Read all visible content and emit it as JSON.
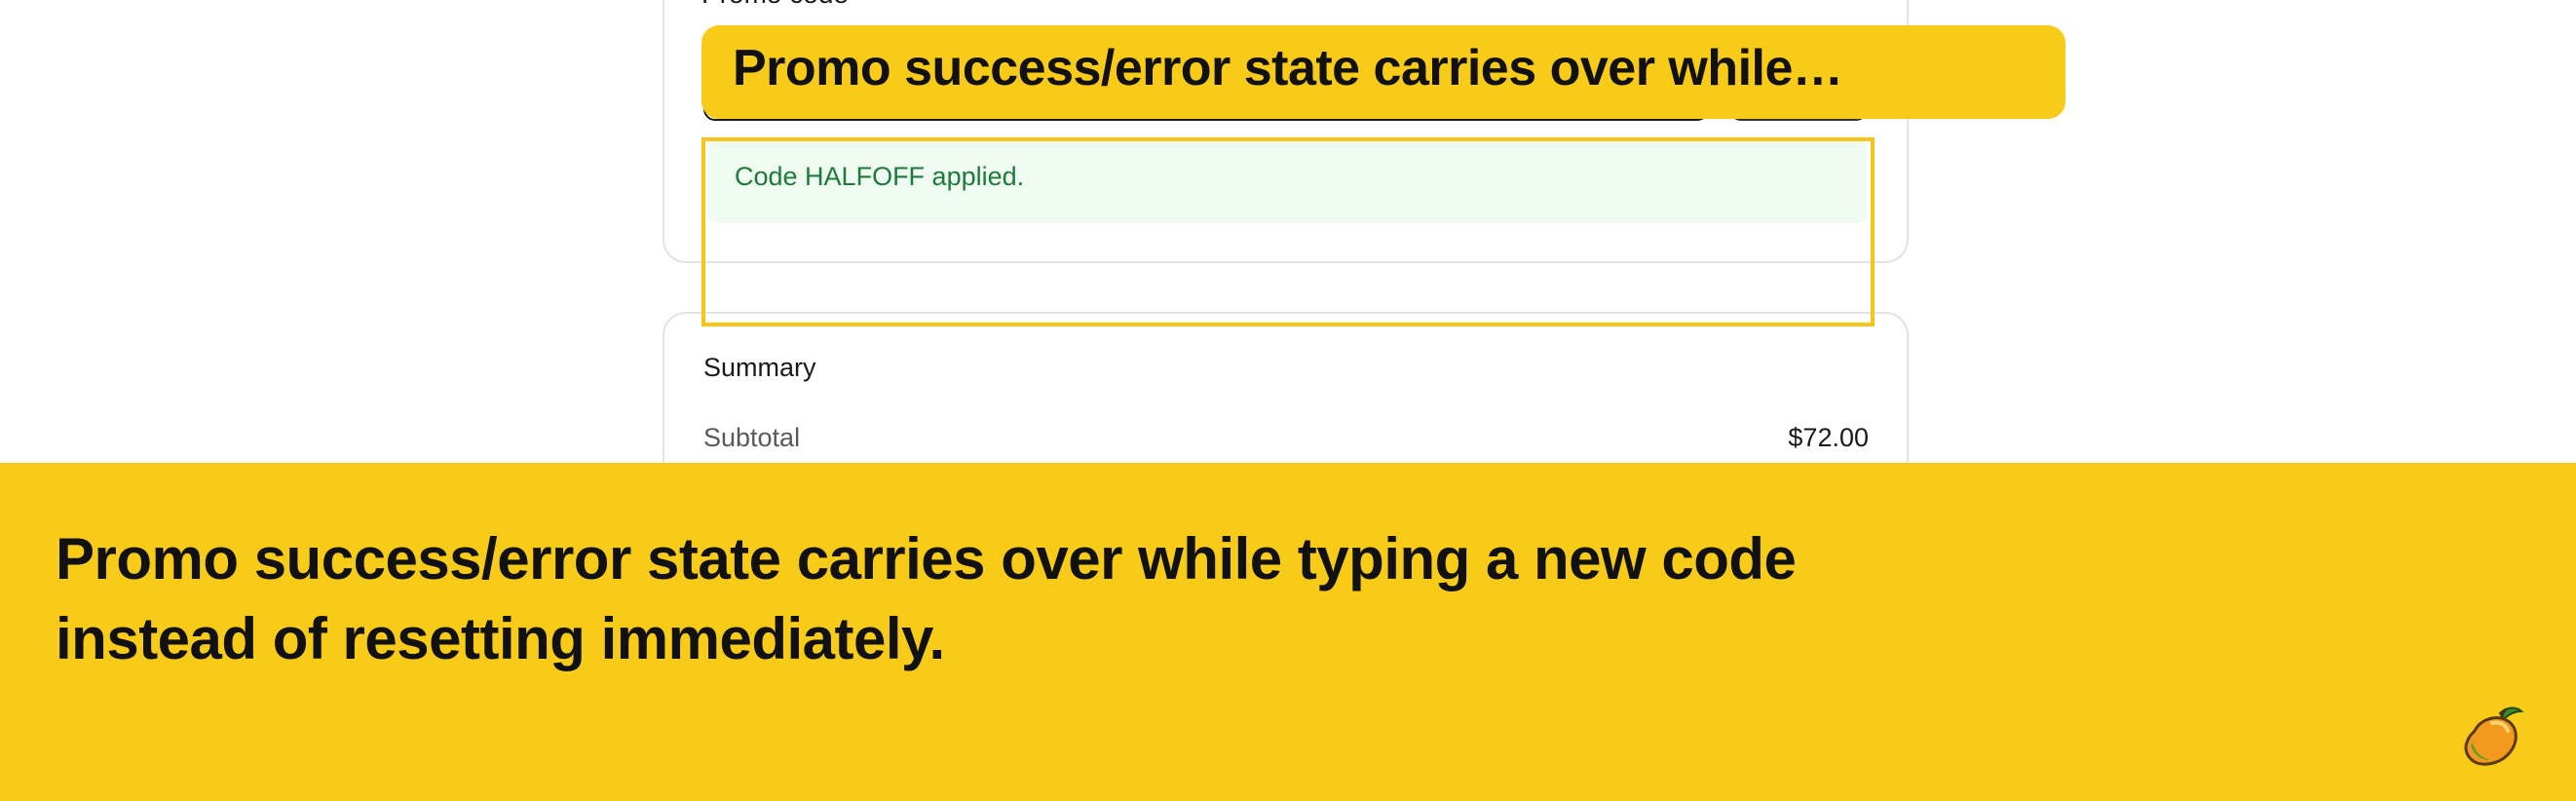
{
  "promo": {
    "label": "Promo code",
    "message": "Code HALFOFF applied."
  },
  "summary": {
    "title": "Summary",
    "subtotal_label": "Subtotal",
    "subtotal_value": "$72.00"
  },
  "annotation": {
    "callout": "Promo success/error state carries over while…",
    "banner": "Promo success/error state carries over while typing a new code instead of resetting immediately.",
    "accent_color": "#f8cb18",
    "icon": "mango-icon"
  },
  "colors": {
    "success_bg": "#effaf1",
    "success_text": "#1e7a3a",
    "border": "#e3e3e3"
  }
}
